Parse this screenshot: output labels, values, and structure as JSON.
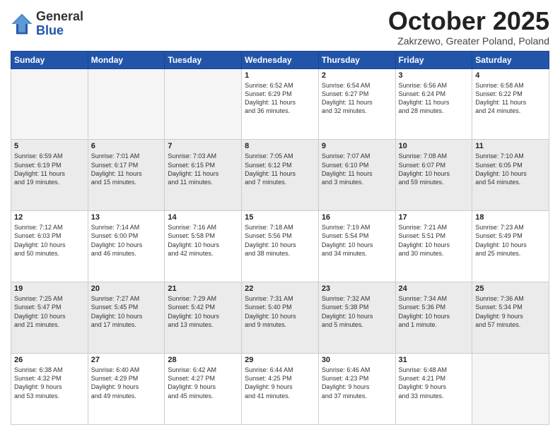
{
  "header": {
    "logo_general": "General",
    "logo_blue": "Blue",
    "month_title": "October 2025",
    "location": "Zakrzewo, Greater Poland, Poland"
  },
  "days_of_week": [
    "Sunday",
    "Monday",
    "Tuesday",
    "Wednesday",
    "Thursday",
    "Friday",
    "Saturday"
  ],
  "weeks": [
    [
      {
        "day": "",
        "info": ""
      },
      {
        "day": "",
        "info": ""
      },
      {
        "day": "",
        "info": ""
      },
      {
        "day": "1",
        "info": "Sunrise: 6:52 AM\nSunset: 6:29 PM\nDaylight: 11 hours\nand 36 minutes."
      },
      {
        "day": "2",
        "info": "Sunrise: 6:54 AM\nSunset: 6:27 PM\nDaylight: 11 hours\nand 32 minutes."
      },
      {
        "day": "3",
        "info": "Sunrise: 6:56 AM\nSunset: 6:24 PM\nDaylight: 11 hours\nand 28 minutes."
      },
      {
        "day": "4",
        "info": "Sunrise: 6:58 AM\nSunset: 6:22 PM\nDaylight: 11 hours\nand 24 minutes."
      }
    ],
    [
      {
        "day": "5",
        "info": "Sunrise: 6:59 AM\nSunset: 6:19 PM\nDaylight: 11 hours\nand 19 minutes."
      },
      {
        "day": "6",
        "info": "Sunrise: 7:01 AM\nSunset: 6:17 PM\nDaylight: 11 hours\nand 15 minutes."
      },
      {
        "day": "7",
        "info": "Sunrise: 7:03 AM\nSunset: 6:15 PM\nDaylight: 11 hours\nand 11 minutes."
      },
      {
        "day": "8",
        "info": "Sunrise: 7:05 AM\nSunset: 6:12 PM\nDaylight: 11 hours\nand 7 minutes."
      },
      {
        "day": "9",
        "info": "Sunrise: 7:07 AM\nSunset: 6:10 PM\nDaylight: 11 hours\nand 3 minutes."
      },
      {
        "day": "10",
        "info": "Sunrise: 7:08 AM\nSunset: 6:07 PM\nDaylight: 10 hours\nand 59 minutes."
      },
      {
        "day": "11",
        "info": "Sunrise: 7:10 AM\nSunset: 6:05 PM\nDaylight: 10 hours\nand 54 minutes."
      }
    ],
    [
      {
        "day": "12",
        "info": "Sunrise: 7:12 AM\nSunset: 6:03 PM\nDaylight: 10 hours\nand 50 minutes."
      },
      {
        "day": "13",
        "info": "Sunrise: 7:14 AM\nSunset: 6:00 PM\nDaylight: 10 hours\nand 46 minutes."
      },
      {
        "day": "14",
        "info": "Sunrise: 7:16 AM\nSunset: 5:58 PM\nDaylight: 10 hours\nand 42 minutes."
      },
      {
        "day": "15",
        "info": "Sunrise: 7:18 AM\nSunset: 5:56 PM\nDaylight: 10 hours\nand 38 minutes."
      },
      {
        "day": "16",
        "info": "Sunrise: 7:19 AM\nSunset: 5:54 PM\nDaylight: 10 hours\nand 34 minutes."
      },
      {
        "day": "17",
        "info": "Sunrise: 7:21 AM\nSunset: 5:51 PM\nDaylight: 10 hours\nand 30 minutes."
      },
      {
        "day": "18",
        "info": "Sunrise: 7:23 AM\nSunset: 5:49 PM\nDaylight: 10 hours\nand 25 minutes."
      }
    ],
    [
      {
        "day": "19",
        "info": "Sunrise: 7:25 AM\nSunset: 5:47 PM\nDaylight: 10 hours\nand 21 minutes."
      },
      {
        "day": "20",
        "info": "Sunrise: 7:27 AM\nSunset: 5:45 PM\nDaylight: 10 hours\nand 17 minutes."
      },
      {
        "day": "21",
        "info": "Sunrise: 7:29 AM\nSunset: 5:42 PM\nDaylight: 10 hours\nand 13 minutes."
      },
      {
        "day": "22",
        "info": "Sunrise: 7:31 AM\nSunset: 5:40 PM\nDaylight: 10 hours\nand 9 minutes."
      },
      {
        "day": "23",
        "info": "Sunrise: 7:32 AM\nSunset: 5:38 PM\nDaylight: 10 hours\nand 5 minutes."
      },
      {
        "day": "24",
        "info": "Sunrise: 7:34 AM\nSunset: 5:36 PM\nDaylight: 10 hours\nand 1 minute."
      },
      {
        "day": "25",
        "info": "Sunrise: 7:36 AM\nSunset: 5:34 PM\nDaylight: 9 hours\nand 57 minutes."
      }
    ],
    [
      {
        "day": "26",
        "info": "Sunrise: 6:38 AM\nSunset: 4:32 PM\nDaylight: 9 hours\nand 53 minutes."
      },
      {
        "day": "27",
        "info": "Sunrise: 6:40 AM\nSunset: 4:29 PM\nDaylight: 9 hours\nand 49 minutes."
      },
      {
        "day": "28",
        "info": "Sunrise: 6:42 AM\nSunset: 4:27 PM\nDaylight: 9 hours\nand 45 minutes."
      },
      {
        "day": "29",
        "info": "Sunrise: 6:44 AM\nSunset: 4:25 PM\nDaylight: 9 hours\nand 41 minutes."
      },
      {
        "day": "30",
        "info": "Sunrise: 6:46 AM\nSunset: 4:23 PM\nDaylight: 9 hours\nand 37 minutes."
      },
      {
        "day": "31",
        "info": "Sunrise: 6:48 AM\nSunset: 4:21 PM\nDaylight: 9 hours\nand 33 minutes."
      },
      {
        "day": "",
        "info": ""
      }
    ]
  ]
}
